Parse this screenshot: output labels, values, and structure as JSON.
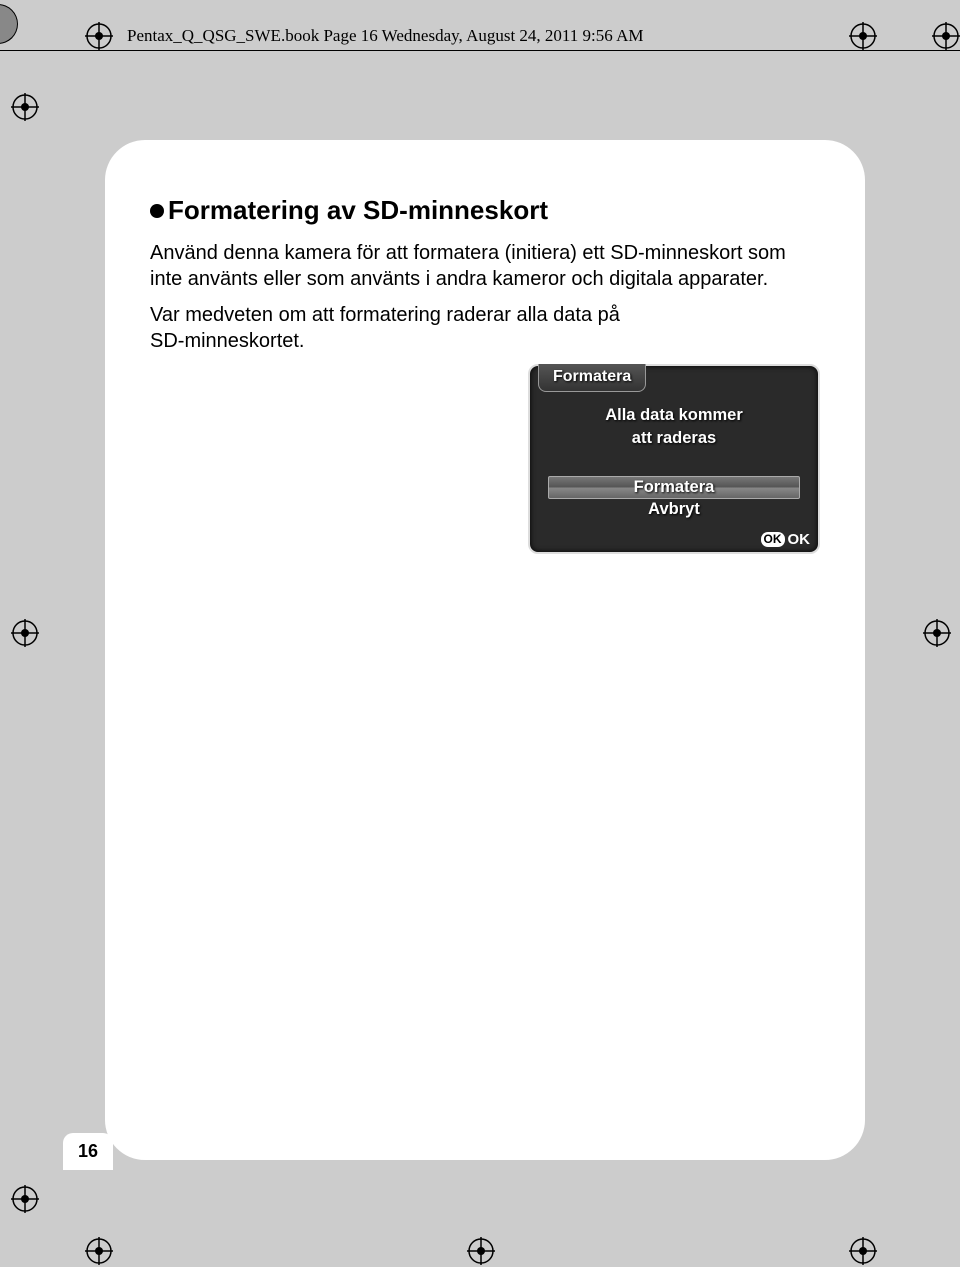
{
  "header": "Pentax_Q_QSG_SWE.book  Page 16  Wednesday, August 24, 2011  9:56 AM",
  "section": {
    "title": "Formatering av SD-minneskort",
    "p1": "Använd denna kamera för att formatera (initiera) ett SD-minneskort som inte använts eller som använts i andra kameror och digitala apparater.",
    "p2": "Var medveten om att formatering raderar alla data på SD-minneskortet."
  },
  "dialog": {
    "tab": "Formatera",
    "msg1": "Alla data kommer",
    "msg2": "att raderas",
    "opt1": "Formatera",
    "opt2": "Avbryt",
    "ok_pill": "OK",
    "ok": "OK"
  },
  "page_number": "16"
}
